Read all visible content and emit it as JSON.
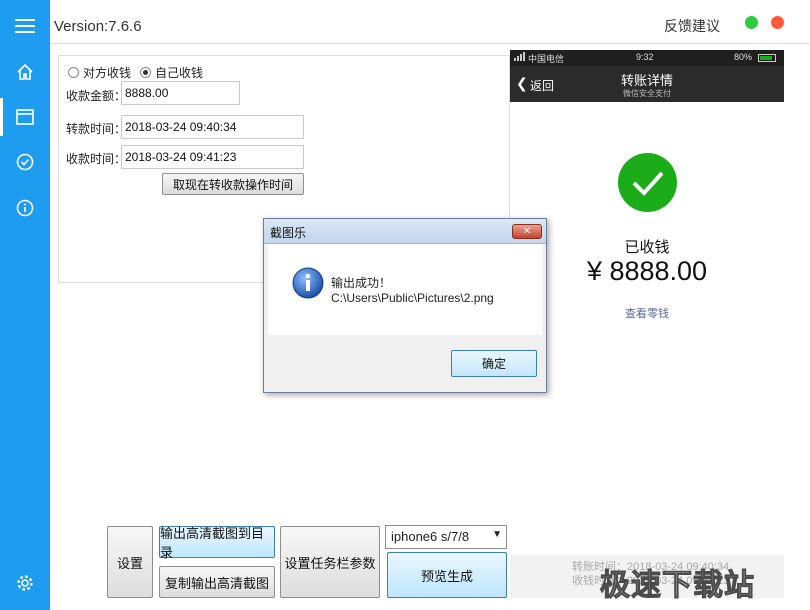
{
  "window": {
    "version": "Version:7.6.6",
    "feedback": "反馈建议",
    "colors": {
      "sidebar": "#1e9df0",
      "min_dot": "#2ecc40",
      "close_dot": "#ff5b3a"
    }
  },
  "sidebar": {
    "items": [
      {
        "icon": "menu-icon"
      },
      {
        "icon": "home-icon"
      },
      {
        "icon": "window-icon"
      },
      {
        "icon": "check-icon"
      },
      {
        "icon": "info-icon"
      },
      {
        "icon": "gear-icon"
      }
    ]
  },
  "form": {
    "radio_other": "对方收钱",
    "radio_self": "自己收钱",
    "selected": "自己收钱",
    "amount_label": "收款金额：",
    "amount_value": "8888.00",
    "transfer_time_label": "转款时间：",
    "transfer_time_value": "2018-03-24 09:40:34",
    "receive_time_label": "收款时间：",
    "receive_time_value": "2018-03-24 09:41:23",
    "take_time_button": "取现在转收款操作时间"
  },
  "preview": {
    "carrier": "中国电信",
    "clock": "9:32",
    "battery": "80%",
    "back": "返回",
    "title": "转账详情",
    "subtitle": "微信安全支付",
    "status": "已收钱",
    "amount": "¥ 8888.00",
    "link": "查看零钱",
    "footer_line1": "转账时间：2018-03-24 09:40:34",
    "footer_line2": "收钱时间：2018-03-24 09:41:23"
  },
  "dialog": {
    "title": "截图乐",
    "message": "输出成功！",
    "path": "C:\\Users\\Public\\Pictures\\2.png",
    "ok": "确定"
  },
  "toolbar": {
    "settings": "设置",
    "export_hd_to_dir": "输出高清截图到目录",
    "copy_hd": "复制输出高清截图",
    "taskbar_params": "设置任务栏参数",
    "device": "iphone6 s/7/8",
    "preview_generate": "预览生成"
  },
  "watermark": "极速下载站"
}
